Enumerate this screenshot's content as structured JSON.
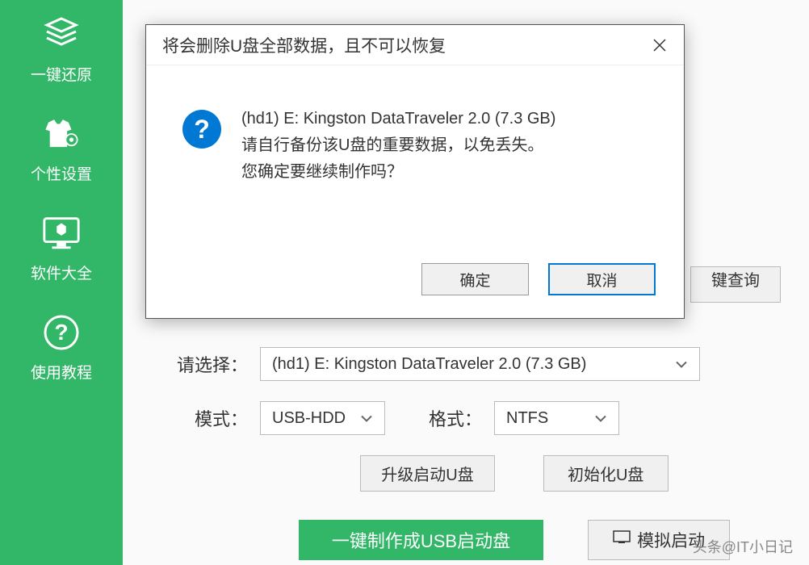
{
  "sidebar": {
    "items": [
      {
        "label": "一键还原"
      },
      {
        "label": "个性设置"
      },
      {
        "label": "软件大全"
      },
      {
        "label": "使用教程"
      }
    ]
  },
  "dialog": {
    "title": "将会删除U盘全部数据，且不可以恢复",
    "message_line1": "(hd1) E: Kingston DataTraveler 2.0 (7.3 GB)",
    "message_line2": "请自行备份该U盘的重要数据，以免丢失。",
    "message_line3": "您确定要继续制作吗？",
    "ok_label": "确定",
    "cancel_label": "取消",
    "icon_char": "?"
  },
  "form": {
    "select_label": "请选择：",
    "select_value": "(hd1) E: Kingston DataTraveler 2.0 (7.3 GB)",
    "mode_label": "模式：",
    "mode_value": "USB-HDD",
    "format_label": "格式：",
    "format_value": "NTFS",
    "upgrade_label": "升级启动U盘",
    "init_label": "初始化U盘",
    "create_label": "一键制作成USB启动盘",
    "simulate_label": "模拟启动",
    "query_label": "键查询"
  },
  "watermark": "头条@IT小日记"
}
